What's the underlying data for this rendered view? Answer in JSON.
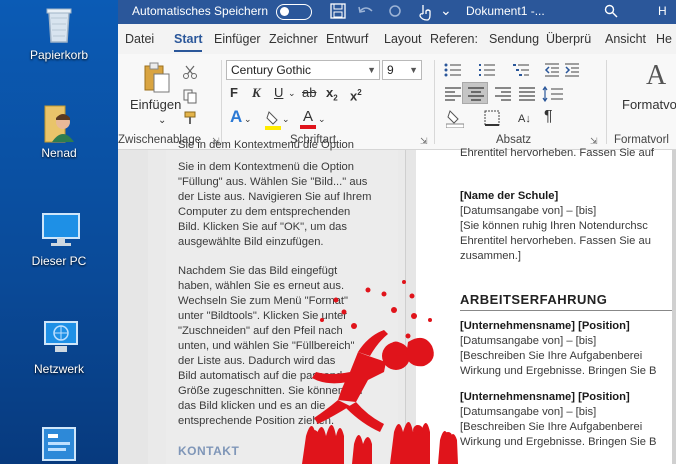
{
  "desktop": {
    "icons": [
      {
        "label": "Papierkorb",
        "icon": "recycle-bin-icon"
      },
      {
        "label": "Nenad",
        "icon": "user-folder-icon"
      },
      {
        "label": "Dieser PC",
        "icon": "computer-icon"
      },
      {
        "label": "Netzwerk",
        "icon": "network-icon"
      },
      {
        "label": "",
        "icon": "control-panel-icon"
      }
    ]
  },
  "titlebar": {
    "autosave_label": "Automatisches Speichern",
    "doc_title": "Dokument1 -...",
    "right_letter": "H"
  },
  "tabs": [
    "Datei",
    "Start",
    "Einfüger",
    "Zeichner",
    "Entwurf",
    "Layout",
    "Referen:",
    "Sendung",
    "Überprü",
    "Ansicht",
    "He"
  ],
  "ribbon": {
    "paste_label": "Einfügen",
    "font_name": "Century Gothic",
    "font_size": "9",
    "groups": {
      "clipboard": "Zwischenablage",
      "font": "Schriftart",
      "paragraph": "Absatz",
      "styles": "Formatvorl"
    },
    "styles_label": "Formatvo"
  },
  "page1": {
    "lines": [
      "Sie in dem Kontextmenü die Option",
      "\"Füllung\" aus. Wählen Sie \"Bild...\" aus",
      "der Liste aus. Navigieren Sie auf Ihrem",
      "Computer zu dem entsprechenden",
      "Bild. Klicken Sie auf \"OK\", um das",
      "ausgewählte Bild einzufügen.",
      "",
      "Nachdem Sie das Bild eingefügt",
      "haben, wählen Sie es erneut aus.",
      "Wechseln Sie zum Menü \"Format\"",
      "unter \"Bildtools\". Klicken Sie unter",
      "\"Zuschneiden\" auf den Pfeil nach",
      "unten, und wählen Sie \"Füllbereich\"",
      "der Liste aus. Dadurch wird das",
      "Bild automatisch auf die passende",
      "Größe zugeschnitten. Sie können auf",
      "das Bild klicken und es an die",
      "entsprechende Position ziehen."
    ],
    "footer_heading": "KONTAKT"
  },
  "page2": {
    "top_line": "Ehrentitel hervorheben. Fassen Sie auf",
    "school_title": "[Name der Schule]",
    "school_lines": [
      "[Datumsangabe von] – [bis]",
      "[Sie können ruhig Ihren Notendurchsc",
      "Ehrentitel hervorheben. Fassen Sie au",
      "zusammen.]"
    ],
    "section_heading": "ARBEITSERFAHRUNG",
    "jobs": [
      {
        "title": "[Unternehmensname] [Position]",
        "lines": [
          "[Datumsangabe von] – [bis]",
          "[Beschreiben Sie Ihre Aufgabenberei",
          "Wirkung und Ergebnisse. Bringen Sie B"
        ]
      },
      {
        "title": "[Unternehmensname] [Position]",
        "lines": [
          "[Datumsangabe von] – [bis]",
          "[Beschreiben Sie Ihre Aufgabenberei",
          "Wirkung und Ergebnisse. Bringen Sie B"
        ]
      }
    ]
  },
  "colors": {
    "word_blue": "#2b579a",
    "desktop_blue": "#0a4d9c",
    "figure_red": "#e0141b"
  }
}
